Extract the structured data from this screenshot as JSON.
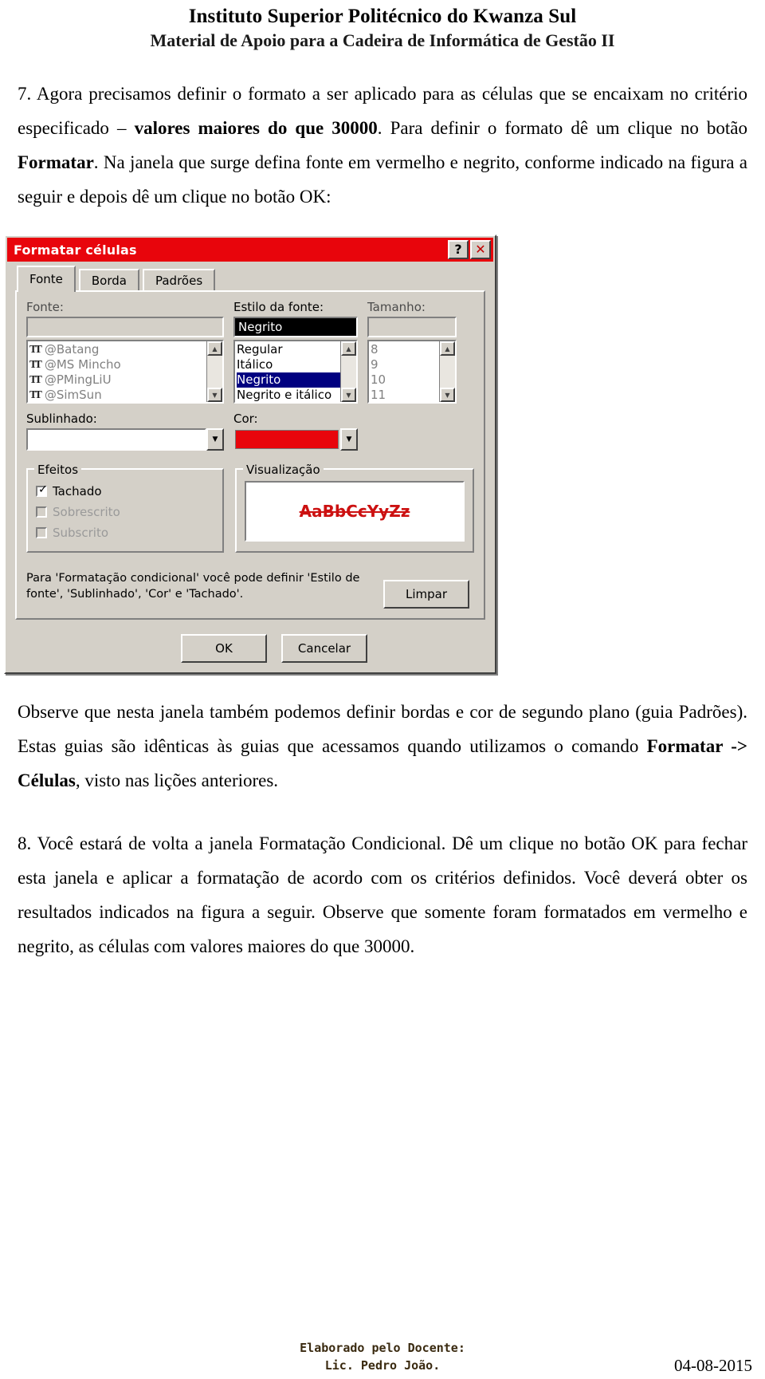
{
  "header": {
    "line1": "Instituto Superior Politécnico do Kwanza Sul",
    "line2": "Material de Apoio para a Cadeira de Informática de Gestão II"
  },
  "paragraph7": {
    "p1": "7. Agora precisamos definir o formato a ser aplicado para as células que se encaixam no critério especificado – ",
    "bold1": "valores maiores do que 30000",
    "p2": ". Para definir o formato dê um clique no botão ",
    "bold2": "Formatar",
    "p3": ". Na janela que surge defina fonte em vermelho e negrito, conforme indicado na figura a seguir e depois dê um clique no botão OK:"
  },
  "dialog": {
    "title": "Formatar células",
    "help_button": "?",
    "close_button": "✕",
    "tabs": [
      {
        "label": "Fonte",
        "active": true
      },
      {
        "label": "Borda",
        "active": false
      },
      {
        "label": "Padrões",
        "active": false
      }
    ],
    "font_label": "Fonte:",
    "font_value": "",
    "font_list": [
      "@Batang",
      "@MS Mincho",
      "@PMingLiU",
      "@SimSun"
    ],
    "style_label": "Estilo da fonte:",
    "style_value": "Negrito",
    "style_list": [
      "Regular",
      "Itálico",
      "Negrito",
      "Negrito e itálico"
    ],
    "style_selected": "Negrito",
    "size_label": "Tamanho:",
    "size_value": "",
    "size_list": [
      "8",
      "9",
      "10",
      "11"
    ],
    "underline_label": "Sublinhado:",
    "underline_value": "",
    "color_label": "Cor:",
    "color_value_hex": "#e8050c",
    "effects_label": "Efeitos",
    "effects": [
      {
        "label": "Tachado",
        "checked": true,
        "disabled": false
      },
      {
        "label": "Sobrescrito",
        "checked": false,
        "disabled": true
      },
      {
        "label": "Subscrito",
        "checked": false,
        "disabled": true
      }
    ],
    "preview_label": "Visualização",
    "preview_text": "AaBbCcYyZz",
    "hint_line1": "Para 'Formatação condicional' você pode definir 'Estilo de",
    "hint_line2": "fonte', 'Sublinhado', 'Cor' e 'Tachado'.",
    "clear_button": "Limpar",
    "ok_button": "OK",
    "cancel_button": "Cancelar",
    "titlebar_color_hex": "#e8050c"
  },
  "paragraph_after": {
    "p1": "Observe que nesta janela também podemos definir bordas e cor de segundo plano (guia Padrões). Estas guias são idênticas às guias que acessamos quando utilizamos o comando ",
    "bold1": "Formatar -> Células",
    "p2": ", visto nas lições anteriores."
  },
  "paragraph8": {
    "p1": "8. Você estará de volta a janela Formatação Condicional. Dê um clique no botão OK para fechar esta janela e aplicar a formatação de acordo com os critérios definidos. Você deverá obter os resultados indicados na figura a seguir. Observe que somente foram formatados em vermelho e negrito, as células com valores maiores do que 30000."
  },
  "footer": {
    "credit_line1": "Elaborado pelo Docente:",
    "credit_line2": "Lic. Pedro João.",
    "date": "04-08-2015"
  }
}
